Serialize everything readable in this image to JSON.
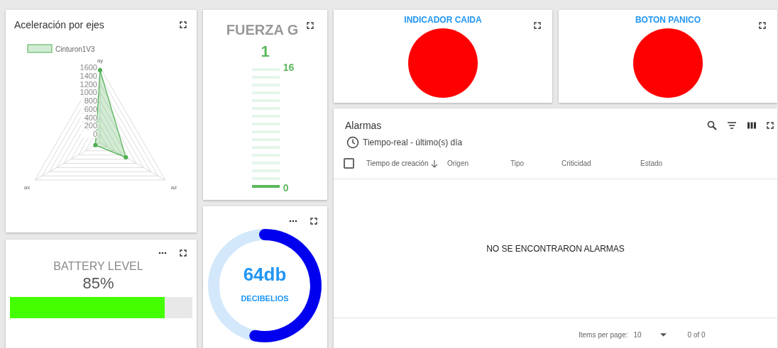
{
  "acceleration_card": {
    "title": "Aceleración por ejes",
    "chart_data": {
      "type": "radar",
      "categories": [
        "ay",
        "az",
        "ax"
      ],
      "ylim": [
        -200,
        1600
      ],
      "yticks": [
        0,
        200,
        400,
        600,
        800,
        1000,
        1200,
        1400,
        1600
      ],
      "series": [
        {
          "name": "Cinturon1V3",
          "color": "#4caf50",
          "values": [
            1530,
            510,
            -70
          ]
        }
      ]
    }
  },
  "battery_card": {
    "title": "BATTERY LEVEL",
    "reading": "85%",
    "level": 0.85
  },
  "g_force_card": {
    "title": "FUERZA G",
    "value": "1",
    "max_label": "16",
    "min_label": "0",
    "level": 0.0625
  },
  "decibel_card": {
    "value": "64db",
    "label": "DECIBELIOS"
  },
  "indicators": [
    {
      "title": "INDICADOR CAIDA",
      "color": "#ff0000"
    },
    {
      "title": "BOTON PANICO",
      "color": "#ff0000"
    }
  ],
  "alarms": {
    "title": "Alarmas",
    "time_window": "Tiempo-real - último(s) día",
    "select_all": {
      "checked": false
    },
    "columns": [
      {
        "label": "Tiempo de creación",
        "sorted": true
      },
      {
        "label": "Origen",
        "sorted": false
      },
      {
        "label": "Tipo",
        "sorted": false
      },
      {
        "label": "Criticidad",
        "sorted": false
      },
      {
        "label": "Estado",
        "sorted": false
      }
    ],
    "empty_message": "NO SE ENCONTRARON ALARMAS",
    "paginator": {
      "items_per_page_label": "Items per page:",
      "page_size": "10",
      "range": "0 of 0"
    }
  }
}
